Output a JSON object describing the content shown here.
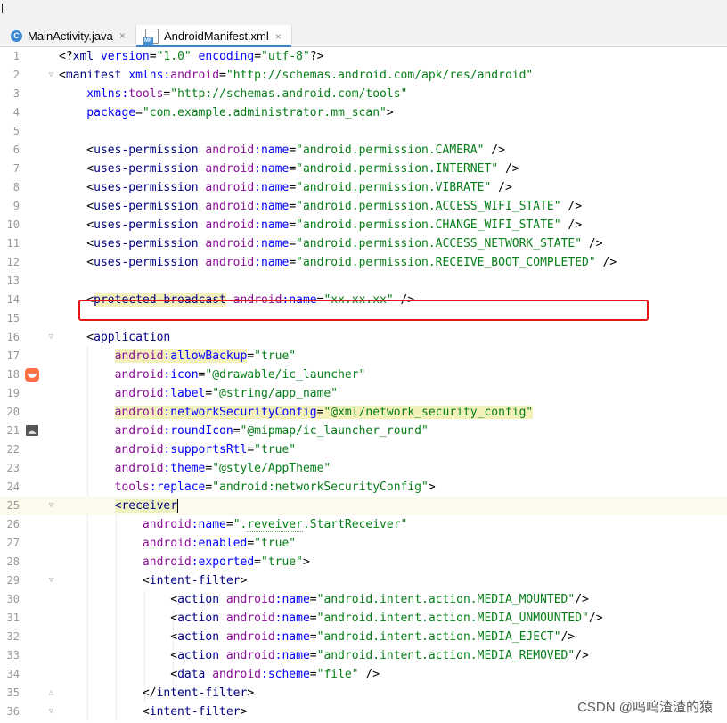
{
  "tabs": [
    {
      "label": "MainActivity.java",
      "icon": "java-class-icon",
      "active": false
    },
    {
      "label": "AndroidManifest.xml",
      "icon": "manifest-file-icon",
      "active": true
    }
  ],
  "close_glyph": "×",
  "watermark": "CSDN @呜呜渣渣的猿",
  "colors": {
    "highlight_box": "#e01818",
    "tag": "#000080",
    "attr": "#0000ff",
    "namespace": "#871094",
    "value": "#067d17"
  },
  "highlighted_line": 12,
  "current_line": 25,
  "lines": [
    {
      "n": "1",
      "segs": [
        [
          "p",
          "<?"
        ],
        [
          "t",
          "xml"
        ],
        [
          "a",
          " version"
        ],
        [
          "p",
          "="
        ],
        [
          "v",
          "\"1.0\""
        ],
        [
          "a",
          " encoding"
        ],
        [
          "p",
          "="
        ],
        [
          "v",
          "\"utf-8\""
        ],
        [
          "p",
          "?>"
        ]
      ]
    },
    {
      "n": "2",
      "segs": [
        [
          "p",
          "<"
        ],
        [
          "t",
          "manifest"
        ],
        [
          "a",
          " xmlns:"
        ],
        [
          "ns",
          "android"
        ],
        [
          "p",
          "="
        ],
        [
          "v",
          "\"http://schemas.android.com/apk/res/android\""
        ]
      ]
    },
    {
      "n": "3",
      "segs": [
        [
          "a",
          "    xmlns:"
        ],
        [
          "ns",
          "tools"
        ],
        [
          "p",
          "="
        ],
        [
          "v",
          "\"http://schemas.android.com/tools\""
        ]
      ]
    },
    {
      "n": "4",
      "segs": [
        [
          "a",
          "    package"
        ],
        [
          "p",
          "="
        ],
        [
          "v",
          "\"com.example.administrator.mm_scan\""
        ],
        [
          "p",
          ">"
        ]
      ]
    },
    {
      "n": "5",
      "segs": []
    },
    {
      "n": "6",
      "segs": [
        [
          "p",
          "    <"
        ],
        [
          "t",
          "uses-permission"
        ],
        [
          "ns",
          " android"
        ],
        [
          "a",
          ":name"
        ],
        [
          "p",
          "="
        ],
        [
          "v",
          "\"android.permission.CAMERA\""
        ],
        [
          "p",
          " />"
        ]
      ]
    },
    {
      "n": "7",
      "segs": [
        [
          "p",
          "    <"
        ],
        [
          "t",
          "uses-permission"
        ],
        [
          "ns",
          " android"
        ],
        [
          "a",
          ":name"
        ],
        [
          "p",
          "="
        ],
        [
          "v",
          "\"android.permission.INTERNET\""
        ],
        [
          "p",
          " />"
        ]
      ]
    },
    {
      "n": "8",
      "segs": [
        [
          "p",
          "    <"
        ],
        [
          "t",
          "uses-permission"
        ],
        [
          "ns",
          " android"
        ],
        [
          "a",
          ":name"
        ],
        [
          "p",
          "="
        ],
        [
          "v",
          "\"android.permission.VIBRATE\""
        ],
        [
          "p",
          " />"
        ]
      ]
    },
    {
      "n": "9",
      "segs": [
        [
          "p",
          "    <"
        ],
        [
          "t",
          "uses-permission"
        ],
        [
          "ns",
          " android"
        ],
        [
          "a",
          ":name"
        ],
        [
          "p",
          "="
        ],
        [
          "v",
          "\"android.permission.ACCESS_WIFI_STATE\""
        ],
        [
          "p",
          " />"
        ]
      ]
    },
    {
      "n": "10",
      "segs": [
        [
          "p",
          "    <"
        ],
        [
          "t",
          "uses-permission"
        ],
        [
          "ns",
          " android"
        ],
        [
          "a",
          ":name"
        ],
        [
          "p",
          "="
        ],
        [
          "v",
          "\"android.permission.CHANGE_WIFI_STATE\""
        ],
        [
          "p",
          " />"
        ]
      ]
    },
    {
      "n": "11",
      "segs": [
        [
          "p",
          "    <"
        ],
        [
          "t",
          "uses-permission"
        ],
        [
          "ns",
          " android"
        ],
        [
          "a",
          ":name"
        ],
        [
          "p",
          "="
        ],
        [
          "v",
          "\"android.permission.ACCESS_NETWORK_STATE\""
        ],
        [
          "p",
          " />"
        ]
      ]
    },
    {
      "n": "12",
      "segs": [
        [
          "p",
          "    <"
        ],
        [
          "t",
          "uses-permission"
        ],
        [
          "ns",
          " android"
        ],
        [
          "a",
          ":name"
        ],
        [
          "p",
          "="
        ],
        [
          "v",
          "\"android.permission.RECEIVE_BOOT_COMPLETED\""
        ],
        [
          "p",
          " />"
        ]
      ]
    },
    {
      "n": "13",
      "segs": []
    },
    {
      "n": "14",
      "segs": [
        [
          "p",
          "    <"
        ],
        [
          "t hl",
          "protected-broadcast"
        ],
        [
          "ns",
          " android"
        ],
        [
          "a",
          ":name"
        ],
        [
          "p",
          "="
        ],
        [
          "v",
          "\"xx.xx.xx\""
        ],
        [
          "p",
          " />"
        ]
      ]
    },
    {
      "n": "15",
      "segs": []
    },
    {
      "n": "16",
      "segs": [
        [
          "p",
          "    <"
        ],
        [
          "t",
          "application"
        ]
      ]
    },
    {
      "n": "17",
      "segs": [
        [
          "p",
          "        "
        ],
        [
          "ns hl",
          "android"
        ],
        [
          "a hl",
          ":allowBackup"
        ],
        [
          "p",
          "="
        ],
        [
          "v",
          "\"true\""
        ]
      ]
    },
    {
      "n": "18",
      "segs": [
        [
          "ns",
          "        android"
        ],
        [
          "a",
          ":icon"
        ],
        [
          "p",
          "="
        ],
        [
          "v",
          "\"@drawable/ic_launcher\""
        ]
      ]
    },
    {
      "n": "19",
      "segs": [
        [
          "ns",
          "        android"
        ],
        [
          "a",
          ":label"
        ],
        [
          "p",
          "="
        ],
        [
          "v",
          "\"@string/app_name\""
        ]
      ]
    },
    {
      "n": "20",
      "segs": [
        [
          "p",
          "        "
        ],
        [
          "ns hl",
          "android"
        ],
        [
          "a hl",
          ":networkSecurityConfig"
        ],
        [
          "p hl",
          "="
        ],
        [
          "v hl",
          "\"@xml/network_security_config\""
        ]
      ]
    },
    {
      "n": "21",
      "segs": [
        [
          "ns",
          "        android"
        ],
        [
          "a",
          ":roundIcon"
        ],
        [
          "p",
          "="
        ],
        [
          "v",
          "\"@mipmap/ic_launcher_round\""
        ]
      ]
    },
    {
      "n": "22",
      "segs": [
        [
          "ns",
          "        android"
        ],
        [
          "a",
          ":supportsRtl"
        ],
        [
          "p",
          "="
        ],
        [
          "v",
          "\"true\""
        ]
      ]
    },
    {
      "n": "23",
      "segs": [
        [
          "ns",
          "        android"
        ],
        [
          "a",
          ":theme"
        ],
        [
          "p",
          "="
        ],
        [
          "v",
          "\"@style/AppTheme\""
        ]
      ]
    },
    {
      "n": "24",
      "segs": [
        [
          "ns",
          "        tools"
        ],
        [
          "a",
          ":replace"
        ],
        [
          "p",
          "="
        ],
        [
          "v",
          "\"android:networkSecurityConfig\""
        ],
        [
          "p",
          ">"
        ]
      ]
    },
    {
      "n": "25",
      "segs": [
        [
          "p",
          "        "
        ],
        [
          "t hl2",
          "<receiver"
        ]
      ]
    },
    {
      "n": "26",
      "segs": [
        [
          "ns",
          "            android"
        ],
        [
          "a",
          ":name"
        ],
        [
          "p",
          "="
        ],
        [
          "v",
          "\"."
        ],
        [
          "v squig",
          "reveiver"
        ],
        [
          "v",
          ".StartReceiver\""
        ]
      ]
    },
    {
      "n": "27",
      "segs": [
        [
          "ns",
          "            android"
        ],
        [
          "a",
          ":enabled"
        ],
        [
          "p",
          "="
        ],
        [
          "v",
          "\"true\""
        ]
      ]
    },
    {
      "n": "28",
      "segs": [
        [
          "ns",
          "            android"
        ],
        [
          "a",
          ":exported"
        ],
        [
          "p",
          "="
        ],
        [
          "v",
          "\"true\""
        ],
        [
          "p",
          ">"
        ]
      ]
    },
    {
      "n": "29",
      "segs": [
        [
          "p",
          "            <"
        ],
        [
          "t",
          "intent-filter"
        ],
        [
          "p",
          ">"
        ]
      ]
    },
    {
      "n": "30",
      "segs": [
        [
          "p",
          "                <"
        ],
        [
          "t",
          "action"
        ],
        [
          "ns",
          " android"
        ],
        [
          "a",
          ":name"
        ],
        [
          "p",
          "="
        ],
        [
          "v",
          "\"android.intent.action.MEDIA_MOUNTED\""
        ],
        [
          "p",
          "/>"
        ]
      ]
    },
    {
      "n": "31",
      "segs": [
        [
          "p",
          "                <"
        ],
        [
          "t",
          "action"
        ],
        [
          "ns",
          " android"
        ],
        [
          "a",
          ":name"
        ],
        [
          "p",
          "="
        ],
        [
          "v",
          "\"android.intent.action.MEDIA_UNMOUNTED\""
        ],
        [
          "p",
          "/>"
        ]
      ]
    },
    {
      "n": "32",
      "segs": [
        [
          "p",
          "                <"
        ],
        [
          "t",
          "action"
        ],
        [
          "ns",
          " android"
        ],
        [
          "a",
          ":name"
        ],
        [
          "p",
          "="
        ],
        [
          "v",
          "\"android.intent.action.MEDIA_EJECT\""
        ],
        [
          "p",
          "/>"
        ]
      ]
    },
    {
      "n": "33",
      "segs": [
        [
          "p",
          "                <"
        ],
        [
          "t",
          "action"
        ],
        [
          "ns",
          " android"
        ],
        [
          "a",
          ":name"
        ],
        [
          "p",
          "="
        ],
        [
          "v",
          "\"android.intent.action.MEDIA_REMOVED\""
        ],
        [
          "p",
          "/>"
        ]
      ]
    },
    {
      "n": "34",
      "segs": [
        [
          "p",
          "                <"
        ],
        [
          "t",
          "data"
        ],
        [
          "ns",
          " android"
        ],
        [
          "a",
          ":scheme"
        ],
        [
          "p",
          "="
        ],
        [
          "v",
          "\"file\""
        ],
        [
          "p",
          " />"
        ]
      ]
    },
    {
      "n": "35",
      "segs": [
        [
          "p",
          "            </"
        ],
        [
          "t",
          "intent-filter"
        ],
        [
          "p",
          ">"
        ]
      ]
    },
    {
      "n": "36",
      "segs": [
        [
          "p",
          "            <"
        ],
        [
          "t",
          "intent-filter"
        ],
        [
          "p",
          ">"
        ]
      ]
    }
  ]
}
